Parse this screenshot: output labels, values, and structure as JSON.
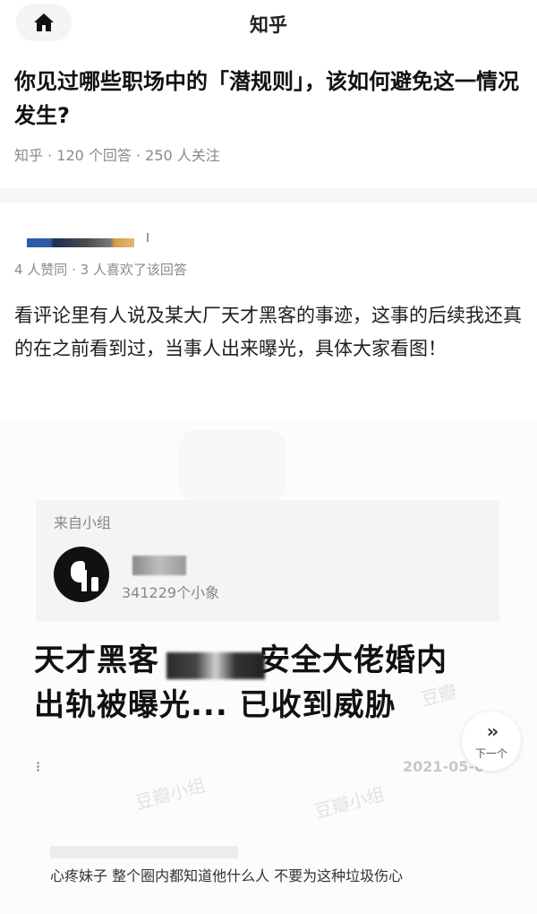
{
  "header": {
    "title": "知乎",
    "home_icon": "home-icon"
  },
  "question": {
    "title": "你见过哪些职场中的「潜规则」，该如何避免这一情况发生?",
    "meta": "知乎 · 120 个回答 · 250 人关注"
  },
  "answer": {
    "meta": "4 人赞同 · 3 人喜欢了该回答",
    "body": "看评论里有人说及某大厂天才黑客的事迹，这事的后续我还真的在之前看到过，当事人出来曝光，具体大家看图！"
  },
  "embed": {
    "group_label": "来自小组",
    "group_members": "341229个小象",
    "post_title_a": "天才黑客",
    "post_title_b": "安全大佬婚内",
    "post_title_c": "出轨被曝光... 已收到威胁",
    "next_label": "下一个",
    "next_icon": "chevrons-right-icon",
    "date": "2021-05-0",
    "comment": "心疼妹子 整个圈内都知道他什么人 不要为这种垃圾伤心"
  }
}
